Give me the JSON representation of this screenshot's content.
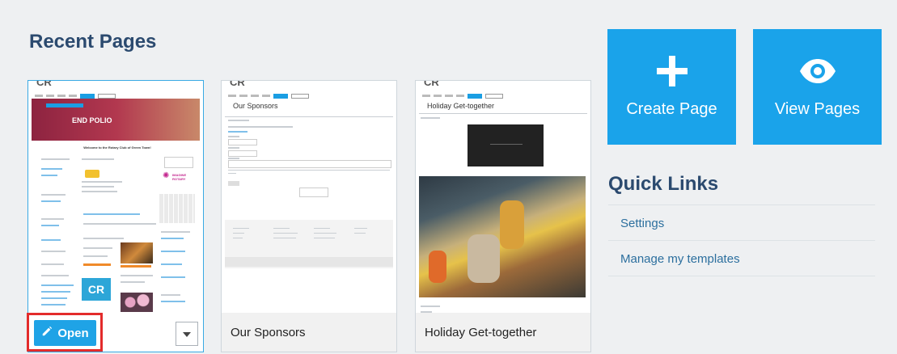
{
  "recent_pages": {
    "title": "Recent Pages",
    "cards": [
      {
        "label": "",
        "thumb_texts": {
          "logo": "CR",
          "hero_text": "END POLIO",
          "welcome": "Welcome to the Rotary Club of Green Town!",
          "imagine": "IMAGINE ROTARY"
        }
      },
      {
        "label": "Our Sponsors",
        "thumb_texts": {
          "logo": "CR",
          "heading": "Our Sponsors"
        }
      },
      {
        "label": "Holiday Get-together",
        "thumb_texts": {
          "logo": "CR",
          "heading": "Holiday Get-together"
        }
      }
    ],
    "open_label": "Open"
  },
  "actions": {
    "create_label": "Create Page",
    "view_label": "View Pages"
  },
  "quick_links": {
    "title": "Quick Links",
    "items": [
      "Settings",
      "Manage my templates"
    ]
  },
  "colors": {
    "accent": "#1aa3ea",
    "title": "#2b4a6f",
    "link": "#2c6f9e",
    "highlight": "#e32b2b"
  }
}
